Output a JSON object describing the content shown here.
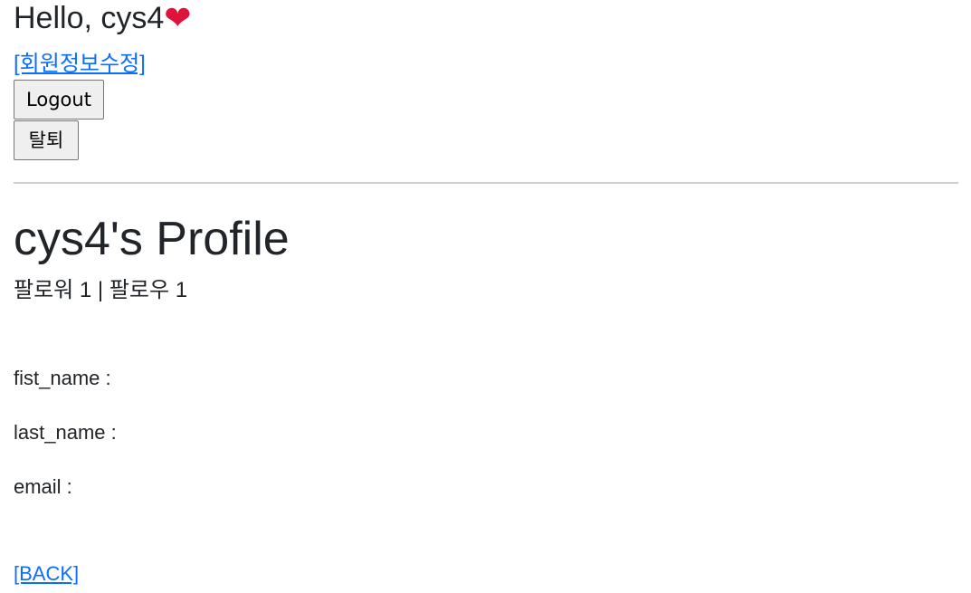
{
  "header": {
    "greeting": "Hello, cys4",
    "heart_icon": "heart-icon",
    "heart_color": "#e0113a",
    "edit_profile_link": "[회원정보수정]",
    "logout_label": "Logout",
    "withdraw_label": "탈퇴"
  },
  "profile": {
    "title": "cys4's Profile",
    "follow_summary": "팔로워 1 | 팔로우 1",
    "fields": {
      "first_name_label": "fist_name :",
      "last_name_label": "last_name :",
      "email_label": "email :"
    },
    "back_link": "[BACK]"
  },
  "colors": {
    "link": "#0d6efd",
    "text": "#212529"
  }
}
